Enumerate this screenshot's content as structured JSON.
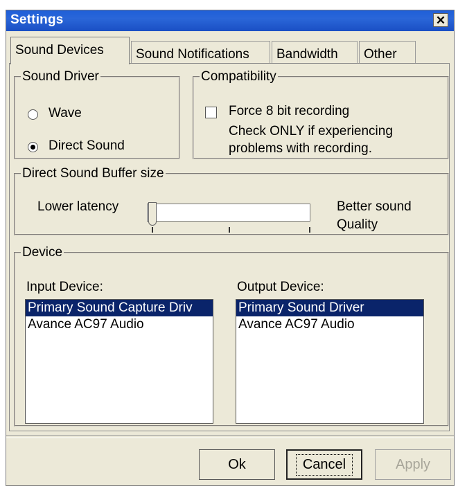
{
  "window": {
    "title": "Settings",
    "close_glyph": "✕"
  },
  "tabs": [
    "Sound Devices",
    "Sound Notifications",
    "Bandwidth",
    "Other"
  ],
  "sound_driver": {
    "legend": "Sound Driver",
    "options": [
      "Wave",
      "Direct Sound"
    ],
    "selected": "Direct Sound"
  },
  "compatibility": {
    "legend": "Compatibility",
    "checkbox_label": "Force 8 bit recording",
    "checked": false,
    "note_line1": "Check ONLY if experiencing",
    "note_line2": "problems with recording."
  },
  "buffer": {
    "legend": "Direct Sound Buffer size",
    "left_label": "Lower latency",
    "right_label_line1": "Better sound",
    "right_label_line2": "Quality",
    "value_fraction": 0.0
  },
  "device": {
    "legend": "Device",
    "input_label": "Input Device:",
    "output_label": "Output Device:",
    "input_items": [
      "Primary Sound Capture Driv",
      "Avance AC97 Audio"
    ],
    "output_items": [
      "Primary Sound Driver",
      "Avance AC97 Audio"
    ]
  },
  "buttons": {
    "ok": "Ok",
    "cancel": "Cancel",
    "apply": "Apply"
  }
}
